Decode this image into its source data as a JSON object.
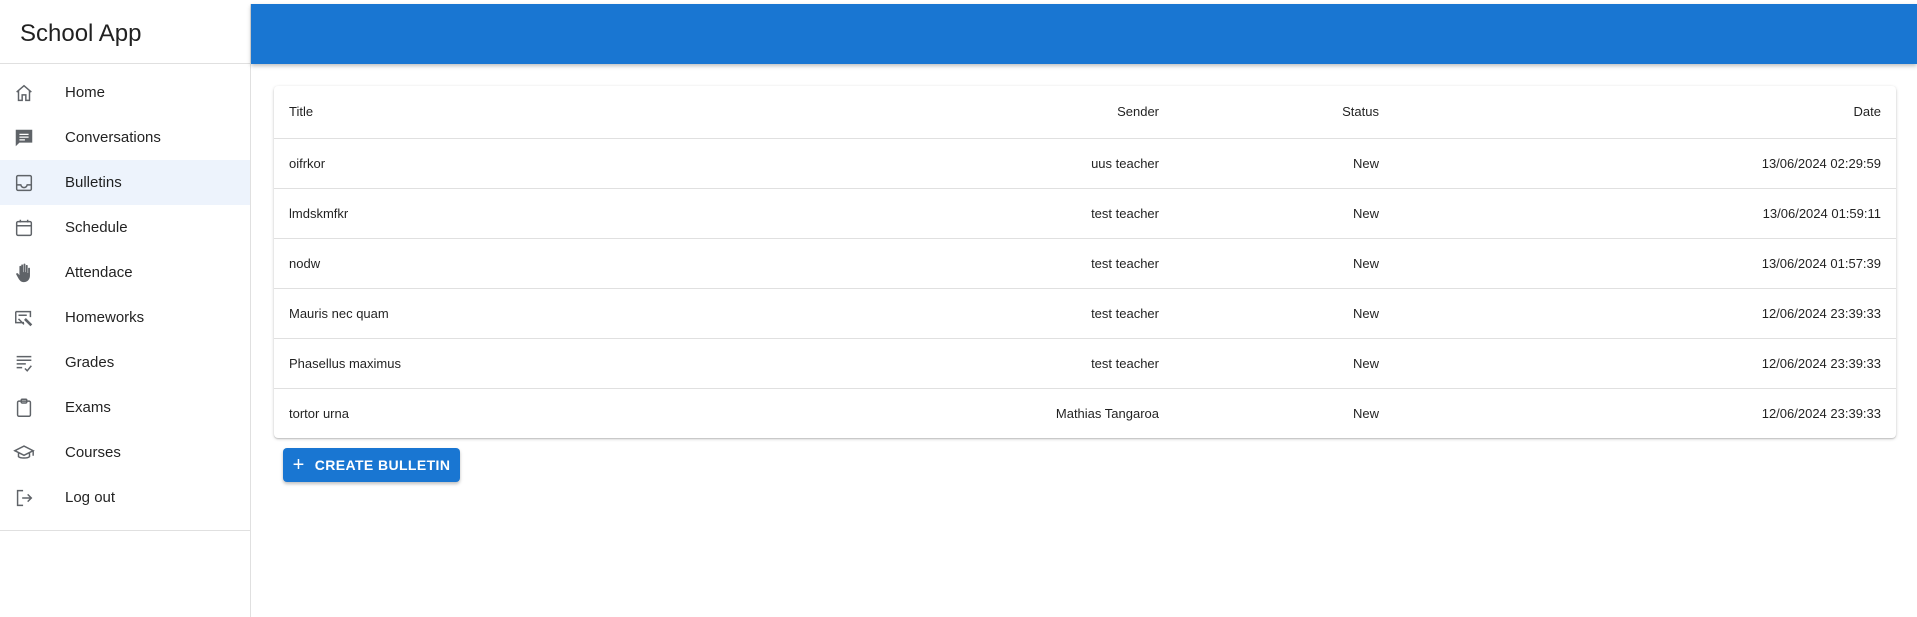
{
  "app": {
    "title": "School App"
  },
  "colors": {
    "primary": "#1976d2",
    "active_bg": "#edf3fc"
  },
  "sidebar": {
    "items": [
      {
        "label": "Home",
        "icon": "home-icon"
      },
      {
        "label": "Conversations",
        "icon": "chat-icon"
      },
      {
        "label": "Bulletins",
        "icon": "inbox-icon",
        "active": true
      },
      {
        "label": "Schedule",
        "icon": "calendar-icon"
      },
      {
        "label": "Attendace",
        "icon": "hand-icon"
      },
      {
        "label": "Homeworks",
        "icon": "homework-icon"
      },
      {
        "label": "Grades",
        "icon": "grades-icon"
      },
      {
        "label": "Exams",
        "icon": "clipboard-icon"
      },
      {
        "label": "Courses",
        "icon": "school-icon"
      },
      {
        "label": "Log out",
        "icon": "logout-icon"
      }
    ]
  },
  "table": {
    "headers": {
      "title": "Title",
      "sender": "Sender",
      "status": "Status",
      "date": "Date"
    },
    "rows": [
      {
        "title": "oifrkor",
        "sender": "uus teacher",
        "status": "New",
        "date": "13/06/2024 02:29:59"
      },
      {
        "title": "lmdskmfkr",
        "sender": "test teacher",
        "status": "New",
        "date": "13/06/2024 01:59:11"
      },
      {
        "title": "nodw",
        "sender": "test teacher",
        "status": "New",
        "date": "13/06/2024 01:57:39"
      },
      {
        "title": "Mauris nec quam",
        "sender": "test teacher",
        "status": "New",
        "date": "12/06/2024 23:39:33"
      },
      {
        "title": "Phasellus maximus",
        "sender": "test teacher",
        "status": "New",
        "date": "12/06/2024 23:39:33"
      },
      {
        "title": "tortor urna",
        "sender": "Mathias Tangaroa",
        "status": "New",
        "date": "12/06/2024 23:39:33"
      }
    ]
  },
  "actions": {
    "create_label": "CREATE BULLETIN",
    "create_icon": "plus-icon"
  }
}
